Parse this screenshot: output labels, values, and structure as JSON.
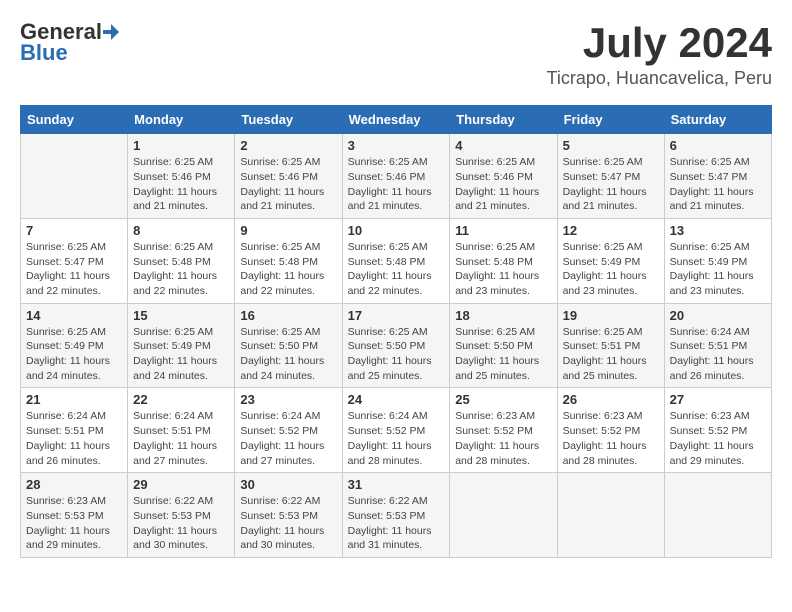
{
  "header": {
    "logo_general": "General",
    "logo_blue": "Blue",
    "month_year": "July 2024",
    "location": "Ticrapo, Huancavelica, Peru"
  },
  "weekdays": [
    "Sunday",
    "Monday",
    "Tuesday",
    "Wednesday",
    "Thursday",
    "Friday",
    "Saturday"
  ],
  "weeks": [
    [
      {
        "day": "",
        "sunrise": "",
        "sunset": "",
        "daylight": ""
      },
      {
        "day": "1",
        "sunrise": "Sunrise: 6:25 AM",
        "sunset": "Sunset: 5:46 PM",
        "daylight": "Daylight: 11 hours and 21 minutes."
      },
      {
        "day": "2",
        "sunrise": "Sunrise: 6:25 AM",
        "sunset": "Sunset: 5:46 PM",
        "daylight": "Daylight: 11 hours and 21 minutes."
      },
      {
        "day": "3",
        "sunrise": "Sunrise: 6:25 AM",
        "sunset": "Sunset: 5:46 PM",
        "daylight": "Daylight: 11 hours and 21 minutes."
      },
      {
        "day": "4",
        "sunrise": "Sunrise: 6:25 AM",
        "sunset": "Sunset: 5:46 PM",
        "daylight": "Daylight: 11 hours and 21 minutes."
      },
      {
        "day": "5",
        "sunrise": "Sunrise: 6:25 AM",
        "sunset": "Sunset: 5:47 PM",
        "daylight": "Daylight: 11 hours and 21 minutes."
      },
      {
        "day": "6",
        "sunrise": "Sunrise: 6:25 AM",
        "sunset": "Sunset: 5:47 PM",
        "daylight": "Daylight: 11 hours and 21 minutes."
      }
    ],
    [
      {
        "day": "7",
        "sunrise": "Sunrise: 6:25 AM",
        "sunset": "Sunset: 5:47 PM",
        "daylight": "Daylight: 11 hours and 22 minutes."
      },
      {
        "day": "8",
        "sunrise": "Sunrise: 6:25 AM",
        "sunset": "Sunset: 5:48 PM",
        "daylight": "Daylight: 11 hours and 22 minutes."
      },
      {
        "day": "9",
        "sunrise": "Sunrise: 6:25 AM",
        "sunset": "Sunset: 5:48 PM",
        "daylight": "Daylight: 11 hours and 22 minutes."
      },
      {
        "day": "10",
        "sunrise": "Sunrise: 6:25 AM",
        "sunset": "Sunset: 5:48 PM",
        "daylight": "Daylight: 11 hours and 22 minutes."
      },
      {
        "day": "11",
        "sunrise": "Sunrise: 6:25 AM",
        "sunset": "Sunset: 5:48 PM",
        "daylight": "Daylight: 11 hours and 23 minutes."
      },
      {
        "day": "12",
        "sunrise": "Sunrise: 6:25 AM",
        "sunset": "Sunset: 5:49 PM",
        "daylight": "Daylight: 11 hours and 23 minutes."
      },
      {
        "day": "13",
        "sunrise": "Sunrise: 6:25 AM",
        "sunset": "Sunset: 5:49 PM",
        "daylight": "Daylight: 11 hours and 23 minutes."
      }
    ],
    [
      {
        "day": "14",
        "sunrise": "Sunrise: 6:25 AM",
        "sunset": "Sunset: 5:49 PM",
        "daylight": "Daylight: 11 hours and 24 minutes."
      },
      {
        "day": "15",
        "sunrise": "Sunrise: 6:25 AM",
        "sunset": "Sunset: 5:49 PM",
        "daylight": "Daylight: 11 hours and 24 minutes."
      },
      {
        "day": "16",
        "sunrise": "Sunrise: 6:25 AM",
        "sunset": "Sunset: 5:50 PM",
        "daylight": "Daylight: 11 hours and 24 minutes."
      },
      {
        "day": "17",
        "sunrise": "Sunrise: 6:25 AM",
        "sunset": "Sunset: 5:50 PM",
        "daylight": "Daylight: 11 hours and 25 minutes."
      },
      {
        "day": "18",
        "sunrise": "Sunrise: 6:25 AM",
        "sunset": "Sunset: 5:50 PM",
        "daylight": "Daylight: 11 hours and 25 minutes."
      },
      {
        "day": "19",
        "sunrise": "Sunrise: 6:25 AM",
        "sunset": "Sunset: 5:51 PM",
        "daylight": "Daylight: 11 hours and 25 minutes."
      },
      {
        "day": "20",
        "sunrise": "Sunrise: 6:24 AM",
        "sunset": "Sunset: 5:51 PM",
        "daylight": "Daylight: 11 hours and 26 minutes."
      }
    ],
    [
      {
        "day": "21",
        "sunrise": "Sunrise: 6:24 AM",
        "sunset": "Sunset: 5:51 PM",
        "daylight": "Daylight: 11 hours and 26 minutes."
      },
      {
        "day": "22",
        "sunrise": "Sunrise: 6:24 AM",
        "sunset": "Sunset: 5:51 PM",
        "daylight": "Daylight: 11 hours and 27 minutes."
      },
      {
        "day": "23",
        "sunrise": "Sunrise: 6:24 AM",
        "sunset": "Sunset: 5:52 PM",
        "daylight": "Daylight: 11 hours and 27 minutes."
      },
      {
        "day": "24",
        "sunrise": "Sunrise: 6:24 AM",
        "sunset": "Sunset: 5:52 PM",
        "daylight": "Daylight: 11 hours and 28 minutes."
      },
      {
        "day": "25",
        "sunrise": "Sunrise: 6:23 AM",
        "sunset": "Sunset: 5:52 PM",
        "daylight": "Daylight: 11 hours and 28 minutes."
      },
      {
        "day": "26",
        "sunrise": "Sunrise: 6:23 AM",
        "sunset": "Sunset: 5:52 PM",
        "daylight": "Daylight: 11 hours and 28 minutes."
      },
      {
        "day": "27",
        "sunrise": "Sunrise: 6:23 AM",
        "sunset": "Sunset: 5:52 PM",
        "daylight": "Daylight: 11 hours and 29 minutes."
      }
    ],
    [
      {
        "day": "28",
        "sunrise": "Sunrise: 6:23 AM",
        "sunset": "Sunset: 5:53 PM",
        "daylight": "Daylight: 11 hours and 29 minutes."
      },
      {
        "day": "29",
        "sunrise": "Sunrise: 6:22 AM",
        "sunset": "Sunset: 5:53 PM",
        "daylight": "Daylight: 11 hours and 30 minutes."
      },
      {
        "day": "30",
        "sunrise": "Sunrise: 6:22 AM",
        "sunset": "Sunset: 5:53 PM",
        "daylight": "Daylight: 11 hours and 30 minutes."
      },
      {
        "day": "31",
        "sunrise": "Sunrise: 6:22 AM",
        "sunset": "Sunset: 5:53 PM",
        "daylight": "Daylight: 11 hours and 31 minutes."
      },
      {
        "day": "",
        "sunrise": "",
        "sunset": "",
        "daylight": ""
      },
      {
        "day": "",
        "sunrise": "",
        "sunset": "",
        "daylight": ""
      },
      {
        "day": "",
        "sunrise": "",
        "sunset": "",
        "daylight": ""
      }
    ]
  ]
}
